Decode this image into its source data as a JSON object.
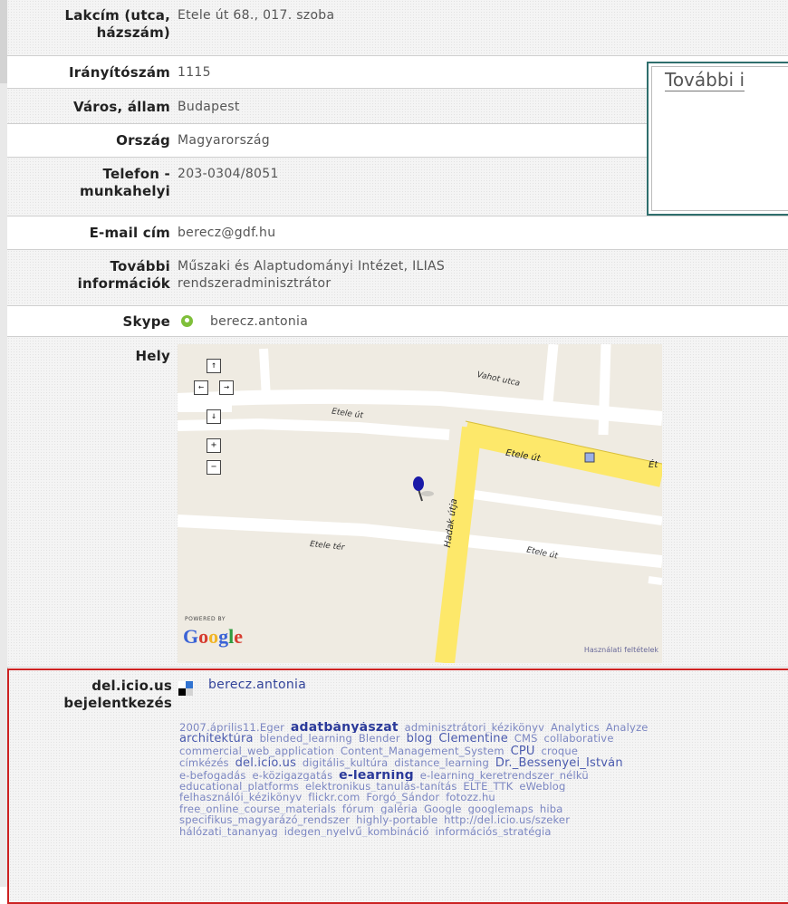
{
  "profile": {
    "rows": [
      {
        "label": "Lakcím (utca, házszám)",
        "value": "Etele út 68., 017. szoba"
      },
      {
        "label": "Irányítószám",
        "value": "1115"
      },
      {
        "label": "Város, állam",
        "value": "Budapest"
      },
      {
        "label": "Ország",
        "value": "Magyarország"
      },
      {
        "label": "Telefon - munkahelyi",
        "value": "203-0304/8051"
      },
      {
        "label": "E-mail cím",
        "value": "berecz@gdf.hu"
      },
      {
        "label": "További információk",
        "value_line1": "Műszaki és Alaptudományi Intézet, ILIAS",
        "value_line2": "rendszeradminisztrátor"
      },
      {
        "label": "Skype",
        "value": "berecz.antonia",
        "icon": "skype-status-icon"
      },
      {
        "label": "Hely"
      }
    ],
    "label_lines": {
      "address": [
        "Lakcím (utca,",
        "házszám)"
      ],
      "phone": [
        "Telefon -",
        "munkahelyi"
      ],
      "info": [
        "További",
        "információk"
      ]
    }
  },
  "info_box": {
    "title": "További i"
  },
  "map": {
    "street_labels": [
      "Vahot utca",
      "Etele út",
      "Etele út",
      "Hadak útja",
      "Etele tér",
      "Etele út",
      "Ét"
    ],
    "controls": {
      "up": "↑",
      "left": "←",
      "right": "→",
      "down": "↓",
      "zoom_in": "+",
      "zoom_out": "−"
    },
    "powered_by": "POWERED BY",
    "brand": "Google",
    "terms": "Használati feltételek",
    "colors": {
      "road_major": "#fde86a",
      "road_minor": "#ffffff",
      "land": "#efebe2",
      "marker": "#1a1aa8"
    }
  },
  "delicious": {
    "label": "del.icio.us bejelentkezés",
    "label_line1": "del.icio.us",
    "label_line2": "bejelentkezés",
    "username": "berecz.antonia",
    "tag_lines": [
      [
        [
          "2007.április11.Eger",
          "n"
        ],
        [
          "adatbányászat",
          "b"
        ],
        [
          "adminisztrátori_kézikönyv",
          "n"
        ],
        [
          "Analytics",
          "n"
        ],
        [
          "Analyze",
          "n"
        ]
      ],
      [
        [
          "architektúra",
          "m"
        ],
        [
          "blended_learning",
          "n"
        ],
        [
          "Blender",
          "n"
        ],
        [
          "blog",
          "m"
        ],
        [
          "Clementine",
          "m"
        ],
        [
          "CMS",
          "n"
        ],
        [
          "collaborative",
          "n"
        ]
      ],
      [
        [
          "commercial_web_application",
          "n"
        ],
        [
          "Content_Management_System",
          "n"
        ],
        [
          "CPU",
          "m"
        ],
        [
          "croque",
          "n"
        ]
      ],
      [
        [
          "címkézés",
          "n"
        ],
        [
          "del.icio.us",
          "m"
        ],
        [
          "digitális_kultúra",
          "n"
        ],
        [
          "distance_learning",
          "n"
        ],
        [
          "Dr._Bessenyei_István",
          "m"
        ]
      ],
      [
        [
          "e-befogadás",
          "n"
        ],
        [
          "e-közigazgatás",
          "n"
        ],
        [
          "e-learning",
          "b"
        ],
        [
          "e-learning_keretrendszer_nélkü",
          "n"
        ]
      ],
      [
        [
          "educational_platforms",
          "n"
        ],
        [
          "elektronikus_tanulás-tanítás",
          "n"
        ],
        [
          "ELTE_TTK",
          "n"
        ],
        [
          "eWeblog",
          "n"
        ]
      ],
      [
        [
          "felhasználói_kézikönyv",
          "n"
        ],
        [
          "flickr.com",
          "n"
        ],
        [
          "Forgó_Sándor",
          "n"
        ],
        [
          "fotozz.hu",
          "n"
        ]
      ],
      [
        [
          "free_online_course_materials",
          "n"
        ],
        [
          "fórum",
          "n"
        ],
        [
          "galéria",
          "n"
        ],
        [
          "Google",
          "n"
        ],
        [
          "googlemaps",
          "n"
        ],
        [
          "hiba",
          "n"
        ]
      ],
      [
        [
          "specifikus_magyarázó_rendszer",
          "n"
        ],
        [
          "highly-portable",
          "n"
        ],
        [
          "http://del.icio.us/szeker",
          "n"
        ]
      ],
      [
        [
          "hálózati_tananyag",
          "n"
        ],
        [
          "idegen_nyelvű_kombináció",
          "n"
        ],
        [
          "információs_stratégia",
          "n"
        ]
      ]
    ]
  }
}
